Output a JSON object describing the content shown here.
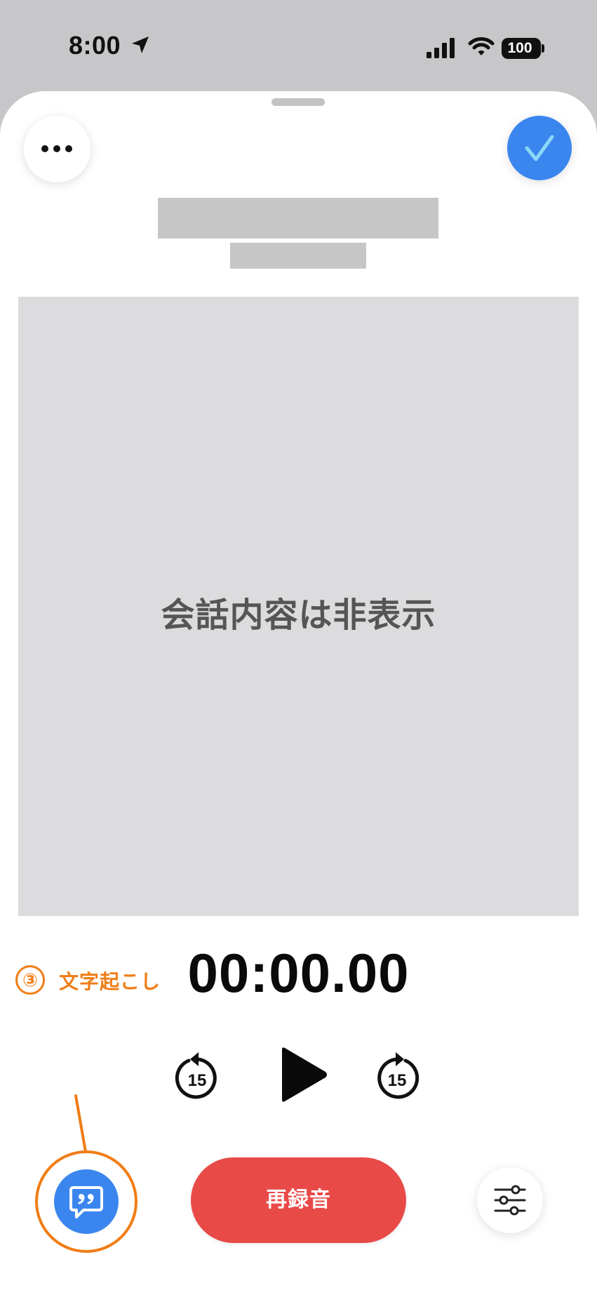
{
  "status_bar": {
    "time": "8:00",
    "battery": "100",
    "icons": [
      "location-arrow-icon",
      "cellular-signal-icon",
      "wifi-icon",
      "battery-icon"
    ]
  },
  "header": {
    "more_icon": "ellipsis-icon",
    "done_icon": "checkmark-icon"
  },
  "transcript": {
    "hidden_label": "会話内容は非表示"
  },
  "player": {
    "elapsed_time": "00:00.00",
    "skip_back_seconds": "15",
    "skip_forward_seconds": "15",
    "play_icon": "play-icon"
  },
  "annotation": {
    "number": "③",
    "label": "文字起こし"
  },
  "bottom_bar": {
    "transcript_icon": "transcript-quote-bubble-icon",
    "rerecord_label": "再録音",
    "settings_icon": "sliders-icon"
  },
  "colors": {
    "accent_blue": "#3a86ee",
    "record_red": "#e84a48",
    "annotation_orange": "#f07d16",
    "placeholder_gray": "#c6c6c6"
  }
}
